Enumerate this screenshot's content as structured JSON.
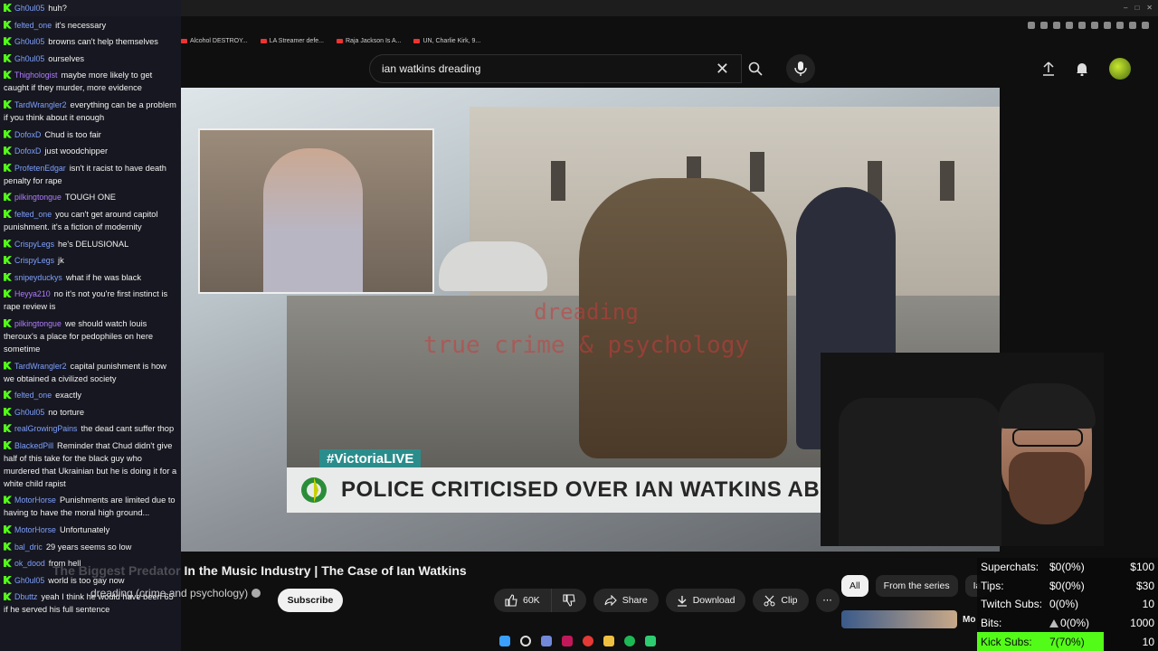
{
  "browser": {
    "bookmarks": [
      "Alcohol DESTROY...",
      "LA Streamer defe...",
      "Raja Jackson Is A...",
      "UN, Charlie Kirk, 9..."
    ]
  },
  "search": {
    "query": "ian watkins dreading"
  },
  "video": {
    "watermark_line1": "dreading",
    "watermark_line2": "true crime & psychology",
    "live_tag": "#VictoriaLIVE",
    "headline": "POLICE CRITICISED OVER IAN WATKINS ABUSE"
  },
  "chat": {
    "messages": [
      {
        "user": "Gh0ul05",
        "text": "huh?",
        "color": "#7ea0ff"
      },
      {
        "user": "felted_one",
        "text": "it's necessary",
        "color": "#7ea0ff"
      },
      {
        "user": "Gh0ul05",
        "text": "browns can't help themselves",
        "color": "#7ea0ff"
      },
      {
        "user": "Gh0ul05",
        "text": "ourselves",
        "color": "#7ea0ff"
      },
      {
        "user": "Thighologist",
        "text": "maybe more likely to get caught if they murder, more evidence",
        "color": "#b07cff"
      },
      {
        "user": "TardWrangler2",
        "text": "everything can be a problem if you think about it enough",
        "color": "#7ea0ff"
      },
      {
        "user": "DofoxD",
        "text": "Chud is too fair",
        "color": "#7ea0ff"
      },
      {
        "user": "DofoxD",
        "text": "just woodchipper",
        "color": "#7ea0ff"
      },
      {
        "user": "ProfetenEdgar",
        "text": "isn't it racist to have death penalty for rape",
        "color": "#7ea0ff"
      },
      {
        "user": "pilkingtongue",
        "text": "TOUGH ONE",
        "color": "#b07cff"
      },
      {
        "user": "felted_one",
        "text": "you can't get around capitol punishment. it's a fiction of modernity",
        "color": "#7ea0ff"
      },
      {
        "user": "CrispyLegs",
        "text": "he's DELUSIONAL",
        "color": "#7ea0ff"
      },
      {
        "user": "CrispyLegs",
        "text": "jk",
        "color": "#7ea0ff"
      },
      {
        "user": "snipeyduckys",
        "text": "what if he was black",
        "color": "#7ea0ff"
      },
      {
        "user": "Heyya210",
        "text": "no it's not you're first instinct is rape review is",
        "color": "#b07cff"
      },
      {
        "user": "pilkingtongue",
        "text": "we should watch louis theroux's a place for pedophiles on here sometime",
        "color": "#b07cff"
      },
      {
        "user": "TardWrangler2",
        "text": "capital punishment is how we obtained a civilized society",
        "color": "#7ea0ff"
      },
      {
        "user": "felted_one",
        "text": "exactly",
        "color": "#7ea0ff"
      },
      {
        "user": "Gh0ul05",
        "text": "no torture",
        "color": "#7ea0ff"
      },
      {
        "user": "realGrowingPains",
        "text": "the dead cant suffer thop",
        "color": "#7ea0ff"
      },
      {
        "user": "BlackedPill",
        "text": "Reminder that Chud didn't give half of this take for the black guy who murdered that Ukrainian but he is doing it for a white child rapist",
        "color": "#7ea0ff"
      },
      {
        "user": "MotorHorse",
        "text": "Punishments are limited due to having to have the moral high ground...",
        "color": "#7ea0ff"
      },
      {
        "user": "MotorHorse",
        "text": "Unfortunately",
        "color": "#7ea0ff"
      },
      {
        "user": "bal_dric",
        "text": "29 years seems so low",
        "color": "#7ea0ff"
      },
      {
        "user": "ok_dood",
        "text": "from hell",
        "color": "#7ea0ff"
      },
      {
        "user": "Gh0ul05",
        "text": "world is too gay now",
        "color": "#7ea0ff"
      },
      {
        "user": "Dbuttz",
        "text": "yeah I think he would have been 65 if he served his full sentence",
        "color": "#7ea0ff"
      }
    ]
  },
  "video_info": {
    "title_hidden": "The Biggest Predator",
    "title": " In the Music Industry | The Case of Ian Watkins",
    "channel": "dreading (crime and psychology)",
    "subscribe_label": "Subscribe",
    "likes": "60K",
    "share_label": "Share",
    "download_label": "Download",
    "clip_label": "Clip"
  },
  "recommend": {
    "chips": [
      "All",
      "From the series",
      "Ia"
    ],
    "next_label": "Mo"
  },
  "stats": {
    "rows": [
      {
        "key": "Superchats:",
        "value": "$0(0%)",
        "goal": "$100"
      },
      {
        "key": "Tips:",
        "value": "$0(0%)",
        "goal": "$30"
      },
      {
        "key": "Twitch Subs:",
        "value": "0(0%)",
        "goal": "10"
      },
      {
        "key": "Bits:",
        "value": "0(0%)",
        "goal": "1000"
      }
    ],
    "kick": {
      "key": "Kick Subs:",
      "value": "7(70%)",
      "goal": "10",
      "progress": 0.7
    }
  },
  "colors": {
    "kick_green": "#53fc18",
    "yt_bg": "#0f0f0f"
  }
}
